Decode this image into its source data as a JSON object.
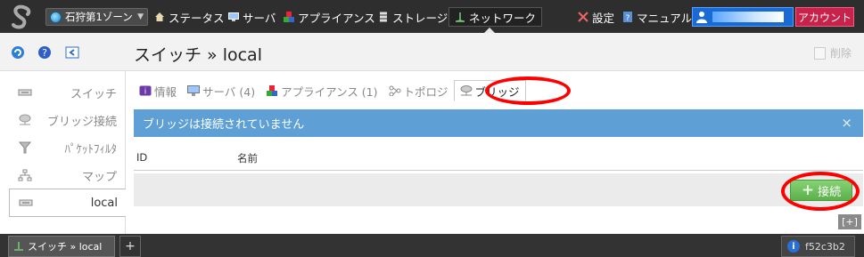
{
  "topbar": {
    "zone_label": "石狩第1ゾーン",
    "nav": [
      {
        "label": "ステータス",
        "icon": "home-icon"
      },
      {
        "label": "サーバ",
        "icon": "monitor-icon"
      },
      {
        "label": "アプライアンス",
        "icon": "blocks-icon"
      },
      {
        "label": "ストレージ",
        "icon": "storage-icon"
      },
      {
        "label": "ネットワーク",
        "icon": "network-icon",
        "active": true
      }
    ],
    "settings_label": "設定",
    "manual_label": "マニュアル",
    "account_label": "アカウント"
  },
  "sidebar": {
    "items": [
      {
        "label": "スイッチ",
        "icon": "switch-icon"
      },
      {
        "label": "ブリッジ接続",
        "icon": "bridge-icon"
      },
      {
        "label": "ﾊﾟｹｯﾄﾌｨﾙﾀ",
        "icon": "filter-icon"
      },
      {
        "label": "マップ",
        "icon": "map-icon"
      },
      {
        "label": "local",
        "icon": "switch-icon",
        "active": true
      }
    ]
  },
  "main": {
    "title": "スイッチ » local",
    "delete_label": "削除",
    "tabs": [
      {
        "label": "情報",
        "icon": "info-icon"
      },
      {
        "label": "サーバ (4)",
        "icon": "monitor-icon"
      },
      {
        "label": "アプライアンス (1)",
        "icon": "blocks-icon"
      },
      {
        "label": "トポロジ",
        "icon": "topology-icon"
      },
      {
        "label": "ブリッジ",
        "icon": "bridge-icon",
        "active": true
      }
    ],
    "alert_text": "ブリッジは接続されていません",
    "alert_close": "×",
    "table_headers": [
      "ID",
      "名前"
    ],
    "connect_label": "接続",
    "expand_label": "[+]"
  },
  "bottombar": {
    "tab_label": "スイッチ » local",
    "add_label": "+",
    "version": "f52c3b2"
  },
  "colors": {
    "alert_bg": "#5e9fd5",
    "account_bg": "#c8224a",
    "connect_bg": "#6ab85a",
    "annotation": "#ff0000"
  }
}
